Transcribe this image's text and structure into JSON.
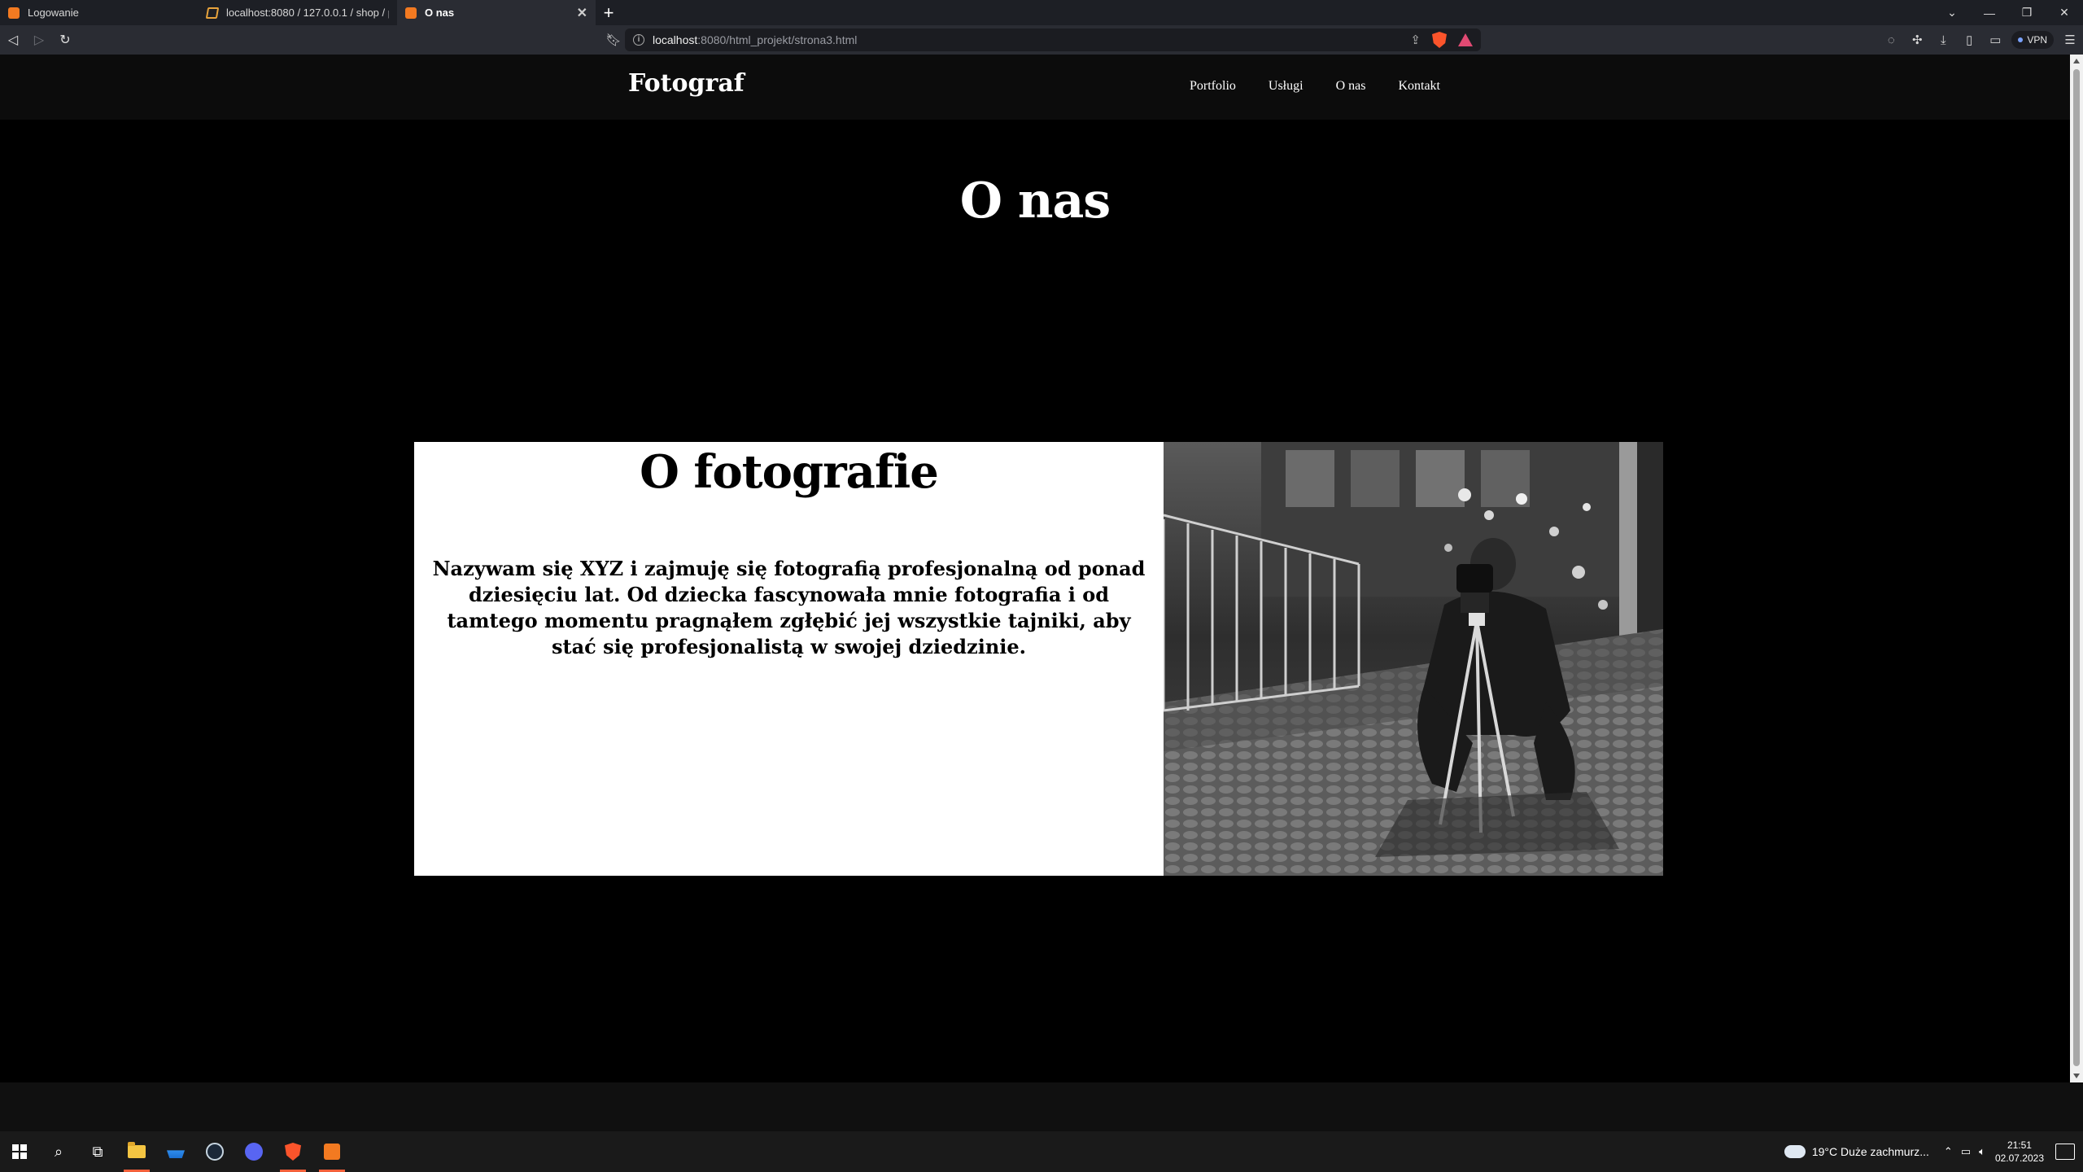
{
  "browser": {
    "tabs": [
      {
        "title": "Logowanie",
        "favicon": "xampp-icon",
        "active": false
      },
      {
        "title": "localhost:8080 / 127.0.0.1 / shop / pro",
        "favicon": "phpmyadmin-icon",
        "active": false
      },
      {
        "title": "O nas",
        "favicon": "xampp-icon",
        "active": true
      }
    ],
    "url_host": "localhost",
    "url_rest": ":8080/html_projekt/strona3.html",
    "vpn_label": "VPN"
  },
  "site": {
    "logo": "Fotograf",
    "nav": [
      "Portfolio",
      "Usługi",
      "O nas",
      "Kontakt"
    ],
    "page_title": "O nas",
    "about_heading": "O fotografie",
    "about_text": "Nazywam się XYZ i zajmuję się fotografią profesjonalną od ponad dziesięciu lat. Od dziecka fascynowała mnie fotografia i od tamtego momentu pragnąłem zgłębić jej wszystkie tajniki, aby stać się profesjonalistą w swojej dziedzinie."
  },
  "taskbar": {
    "weather": "19°C  Duże zachmurz...",
    "time": "21:51",
    "date": "02.07.2023"
  },
  "colors": {
    "page_bg": "#000000",
    "header_bg": "#0c0c0c",
    "card_bg": "#ffffff",
    "brave_accent": "#fb542b"
  }
}
